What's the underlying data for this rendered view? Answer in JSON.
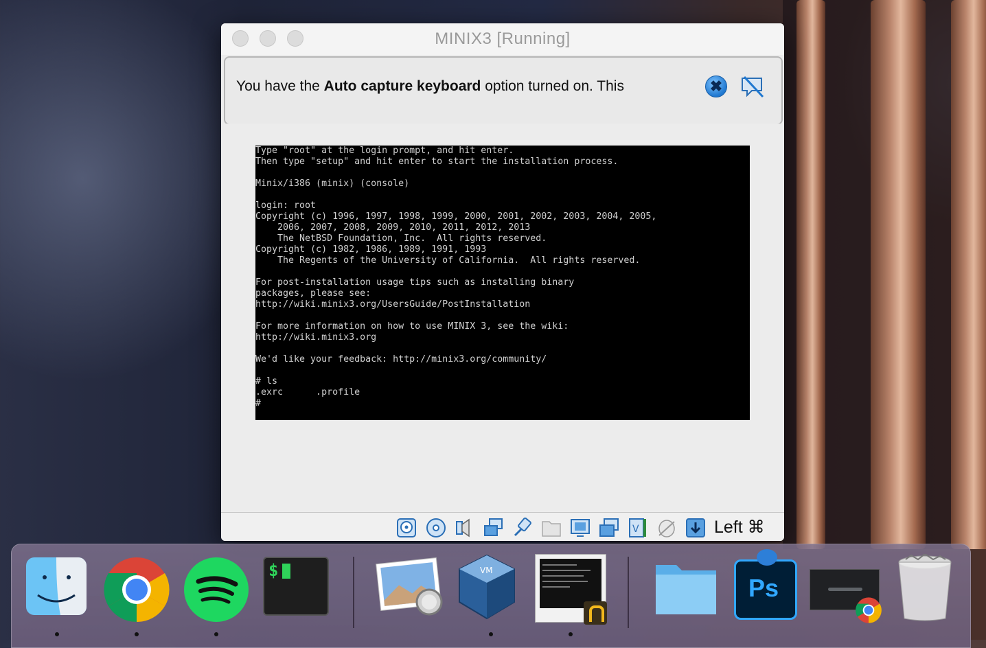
{
  "window": {
    "title": "MINIX3 [Running]"
  },
  "notice": {
    "text_before": "You have the ",
    "text_bold": "Auto capture keyboard",
    "text_after": " option turned on. This"
  },
  "console": {
    "lines": [
      "Type \"root\" at the login prompt, and hit enter.",
      "Then type \"setup\" and hit enter to start the installation process.",
      "",
      "Minix/i386 (minix) (console)",
      "",
      "login: root",
      "Copyright (c) 1996, 1997, 1998, 1999, 2000, 2001, 2002, 2003, 2004, 2005,",
      "    2006, 2007, 2008, 2009, 2010, 2011, 2012, 2013",
      "    The NetBSD Foundation, Inc.  All rights reserved.",
      "Copyright (c) 1982, 1986, 1989, 1991, 1993",
      "    The Regents of the University of California.  All rights reserved.",
      "",
      "For post-installation usage tips such as installing binary",
      "packages, please see:",
      "http://wiki.minix3.org/UsersGuide/PostInstallation",
      "",
      "For more information on how to use MINIX 3, see the wiki:",
      "http://wiki.minix3.org",
      "",
      "We'd like your feedback: http://minix3.org/community/",
      "",
      "# ls",
      ".exrc      .profile",
      "#"
    ]
  },
  "statusbar": {
    "icons": [
      "hard-disk-icon",
      "optical-disk-icon",
      "audio-icon",
      "network-icon",
      "usb-icon",
      "shared-folders-icon",
      "display-icon",
      "video-capture-icon",
      "vt-x-icon",
      "mouse-integration-icon",
      "keyboard-capture-icon"
    ],
    "host_key": "Left ⌘"
  },
  "dock": {
    "apps": [
      "finder",
      "chrome",
      "spotify",
      "terminal",
      "preview",
      "virtualbox",
      "minix3-vm-window",
      "documents-folder",
      "photoshop",
      "chrome-window",
      "trash"
    ],
    "running": [
      "finder",
      "chrome",
      "spotify",
      "virtualbox",
      "minix3-vm-window"
    ],
    "terminal_prompt": "$",
    "photoshop_label": "Ps"
  },
  "colors": {
    "accent": "#1f78d0",
    "console_bg": "#000000",
    "console_fg": "#cfcfcf"
  }
}
